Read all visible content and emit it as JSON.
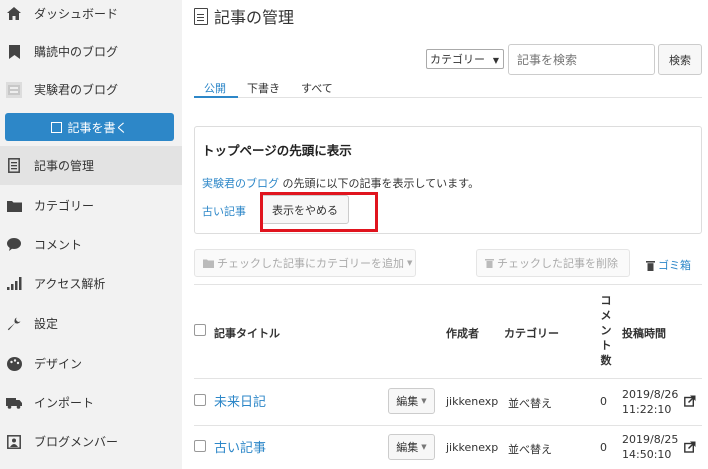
{
  "sidebar": {
    "items": [
      {
        "icon": "home-icon",
        "label": "ダッシュボード"
      },
      {
        "icon": "bookmark-icon",
        "label": "購読中のブログ"
      },
      {
        "icon": "blog-avatar-icon",
        "label": "実験君のブログ"
      },
      {
        "icon": "document-icon",
        "label": "記事の管理"
      },
      {
        "icon": "folder-icon",
        "label": "カテゴリー"
      },
      {
        "icon": "comment-icon",
        "label": "コメント"
      },
      {
        "icon": "bar-chart-icon",
        "label": "アクセス解析"
      },
      {
        "icon": "wrench-icon",
        "label": "設定"
      },
      {
        "icon": "palette-icon",
        "label": "デザイン"
      },
      {
        "icon": "truck-icon",
        "label": "インポート"
      },
      {
        "icon": "members-icon",
        "label": "ブログメンバー"
      }
    ],
    "write_button": "記事を書く",
    "active": "記事の管理"
  },
  "header": {
    "title": "記事の管理"
  },
  "toolbar": {
    "category_select": "カテゴリー",
    "search_placeholder": "記事を検索",
    "search_button": "検索"
  },
  "tabs": [
    "公開",
    "下書き",
    "すべて"
  ],
  "panel": {
    "title": "トップページの先頭に表示",
    "blog_link": "実験君のブログ",
    "text": " の先頭に以下の記事を表示しています。",
    "old_article_link": "古い記事",
    "stop_button": "表示をやめる"
  },
  "actions": {
    "add_category": "チェックした記事にカテゴリーを追加",
    "delete_checked": "チェックした記事を削除",
    "trash": "ゴミ箱"
  },
  "table": {
    "headers": {
      "title": "記事タイトル",
      "author": "作成者",
      "category": "カテゴリー",
      "comments": "コメント数",
      "posted": "投稿時間"
    },
    "rows": [
      {
        "title": "未来日記",
        "edit": "編集",
        "author": "jikkenexp",
        "category": "並べ替え",
        "comments": "0",
        "date": "2019/8/26",
        "time": "11:22:10"
      },
      {
        "title": "古い記事",
        "edit": "編集",
        "author": "jikkenexp",
        "category": "並べ替え",
        "comments": "0",
        "date": "2019/8/25",
        "time": "14:50:10"
      }
    ]
  },
  "colors": {
    "accent": "#2d87c8",
    "highlight": "#e0141e",
    "sidebar_bg": "#f2f2f2"
  }
}
